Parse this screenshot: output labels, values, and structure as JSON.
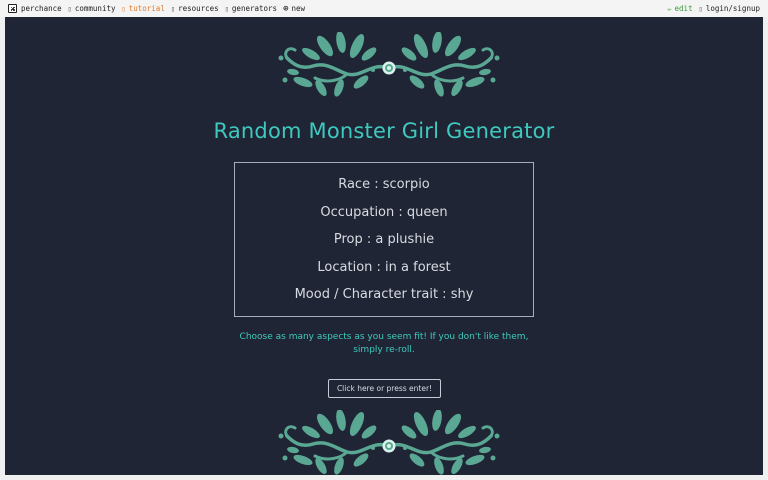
{
  "nav": {
    "items": [
      {
        "label": "perchance",
        "icon": "die-icon",
        "active": false
      },
      {
        "label": "community",
        "icon": "chat-icon",
        "active": false
      },
      {
        "label": "tutorial",
        "icon": "book-icon",
        "active": true
      },
      {
        "label": "resources",
        "icon": "resources-icon",
        "active": false
      },
      {
        "label": "generators",
        "icon": "generators-icon",
        "active": false
      },
      {
        "label": "new",
        "icon": "plus-circle-icon",
        "active": false
      }
    ],
    "edit_label": "edit",
    "login_label": "login/signup"
  },
  "colors": {
    "panel_bg": "#1f2535",
    "accent": "#3fc9be",
    "ornament": "#5aa893",
    "text": "#d9dbe2",
    "active_nav": "#e07a2e",
    "edit_nav": "#3a9a3a"
  },
  "generator": {
    "title": "Random Monster Girl Generator",
    "results": [
      "Race : scorpio",
      "Occupation : queen",
      "Prop : a plushie",
      "Location : in a forest",
      "Mood / Character trait : shy"
    ],
    "hint": "Choose as many aspects as you seem fit! If you don't like them, simply re-roll.",
    "button_label": "Click here or press enter!"
  }
}
